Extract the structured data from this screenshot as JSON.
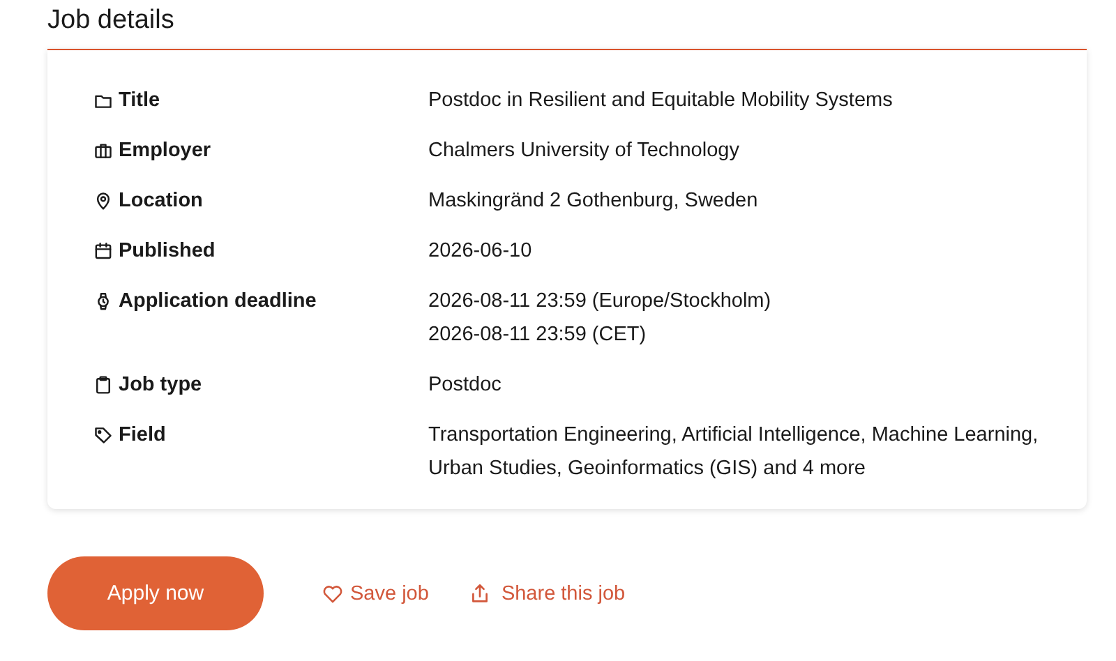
{
  "heading": "Job details",
  "details": [
    {
      "label": "Title",
      "values": [
        "Postdoc in Resilient and Equitable Mobility Systems"
      ]
    },
    {
      "label": "Employer",
      "values": [
        "Chalmers University of Technology"
      ]
    },
    {
      "label": "Location",
      "values": [
        "Maskingränd 2 Gothenburg, Sweden"
      ]
    },
    {
      "label": "Published",
      "values": [
        "2026-06-10"
      ]
    },
    {
      "label": "Application deadline",
      "values": [
        "2026-08-11 23:59 (Europe/Stockholm)",
        "2026-08-11 23:59 (CET)"
      ]
    },
    {
      "label": "Job type",
      "values": [
        "Postdoc"
      ]
    },
    {
      "label": "Field",
      "values": [
        "Transportation Engineering, Artificial Intelligence, Machine Learning, Urban Studies, Geoinformatics (GIS) and 4 more"
      ]
    }
  ],
  "actions": {
    "apply": "Apply now",
    "save": "Save job",
    "share": "Share this job"
  }
}
